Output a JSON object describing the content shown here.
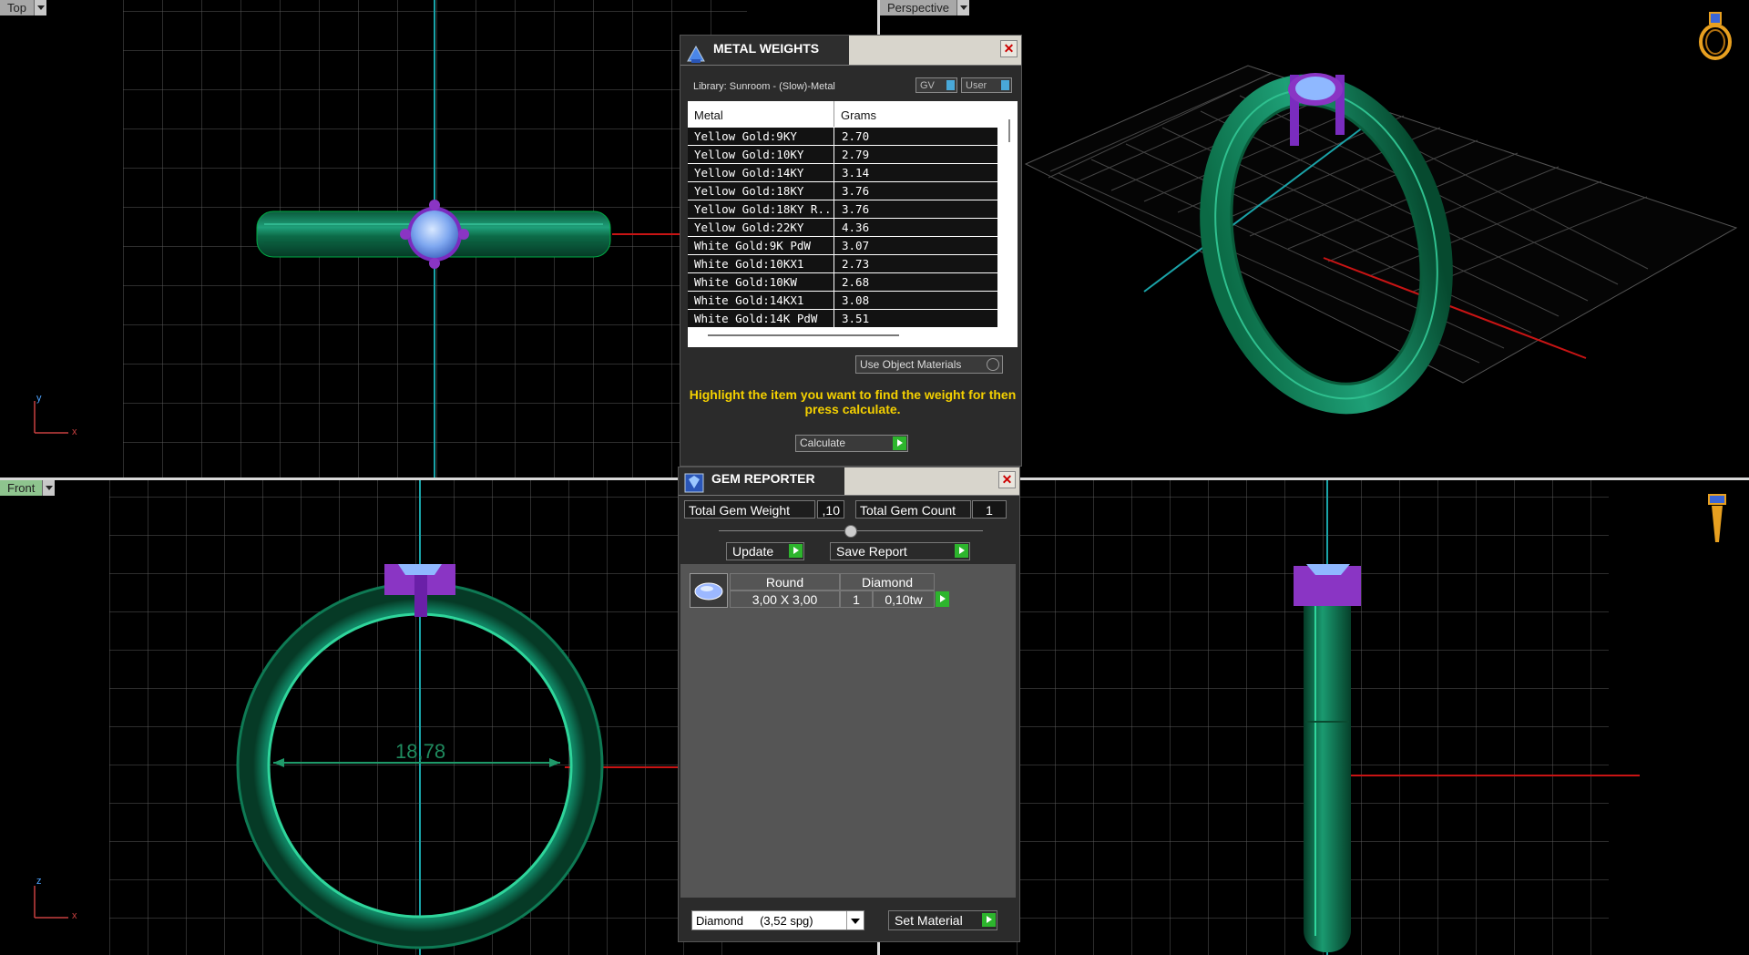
{
  "viewports": {
    "top": {
      "label": "Top"
    },
    "perspective": {
      "label": "Perspective"
    },
    "front": {
      "label": "Front",
      "dimension": "18,78"
    },
    "right": {
      "label": ""
    }
  },
  "axes": {
    "top": {
      "a": "y",
      "b": "x"
    },
    "front": {
      "a": "z",
      "b": "x"
    }
  },
  "metal_weights": {
    "title": "METAL WEIGHTS",
    "library": "Library: Sunroom - (Slow)-Metal",
    "toggle_gv": "GV",
    "toggle_user": "User",
    "columns": {
      "metal": "Metal",
      "grams": "Grams"
    },
    "rows": [
      {
        "metal": "Yellow Gold:9KY",
        "grams": "2.70"
      },
      {
        "metal": "Yellow Gold:10KY",
        "grams": "2.79"
      },
      {
        "metal": "Yellow Gold:14KY",
        "grams": "3.14"
      },
      {
        "metal": "Yellow Gold:18KY",
        "grams": "3.76"
      },
      {
        "metal": "Yellow Gold:18KY R...",
        "grams": "3.76"
      },
      {
        "metal": "Yellow Gold:22KY",
        "grams": "4.36"
      },
      {
        "metal": "White Gold:9K PdW",
        "grams": "3.07"
      },
      {
        "metal": "White Gold:10KX1",
        "grams": "2.73"
      },
      {
        "metal": "White Gold:10KW",
        "grams": "2.68"
      },
      {
        "metal": "White Gold:14KX1",
        "grams": "3.08"
      },
      {
        "metal": "White Gold:14K PdW",
        "grams": "3.51"
      }
    ],
    "use_object_materials": "Use Object Materials",
    "hint": "Highlight the item you want to find the weight for then press calculate.",
    "calculate": "Calculate"
  },
  "gem_reporter": {
    "title": "GEM REPORTER",
    "total_gem_weight_label": "Total Gem Weight",
    "total_gem_weight": ",10",
    "total_gem_count_label": "Total Gem Count",
    "total_gem_count": "1",
    "update": "Update",
    "save_report": "Save Report",
    "gem": {
      "shape": "Round",
      "material": "Diamond",
      "size": "3,00 X 3,00",
      "count": "1",
      "weight": "0,10tw"
    },
    "material_select": "Diamond     (3,52 spg)",
    "set_material": "Set Material"
  },
  "colors": {
    "ring": "#11805a",
    "prong": "#8a35c4",
    "gem": "#8fb8ff",
    "accent_yellow": "#f4d000",
    "play_green": "#2db52d"
  }
}
